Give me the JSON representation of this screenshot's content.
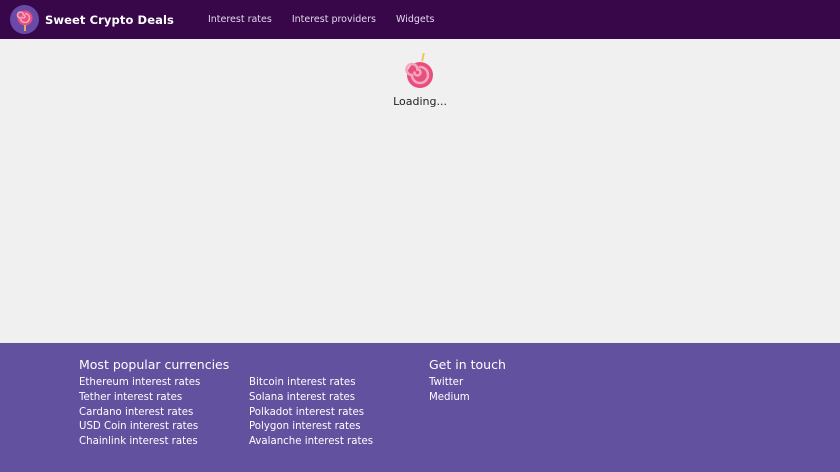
{
  "header": {
    "brand_name": "Sweet Crypto Deals",
    "nav": [
      {
        "label": "Interest rates"
      },
      {
        "label": "Interest providers"
      },
      {
        "label": "Widgets"
      }
    ]
  },
  "main": {
    "loading_text": "Loading..."
  },
  "footer": {
    "popular_heading": "Most popular currencies",
    "popular_col1": [
      {
        "label": "Ethereum interest rates"
      },
      {
        "label": "Tether interest rates"
      },
      {
        "label": "Cardano interest rates"
      },
      {
        "label": "USD Coin interest rates"
      },
      {
        "label": "Chainlink interest rates"
      }
    ],
    "popular_col2": [
      {
        "label": "Bitcoin interest rates"
      },
      {
        "label": "Solana interest rates"
      },
      {
        "label": "Polkadot interest rates"
      },
      {
        "label": "Polygon interest rates"
      },
      {
        "label": "Avalanche interest rates"
      }
    ],
    "contact_heading": "Get in touch",
    "contact_links": [
      {
        "label": "Twitter"
      },
      {
        "label": "Medium"
      }
    ]
  },
  "colors": {
    "header_bg": "#38074a",
    "footer_bg": "#61519f",
    "page_bg": "#f0f0f0",
    "logo_pink": "#e84f7d",
    "logo_light": "#f6a7bf"
  },
  "icons": {
    "brand": "lollipop-icon",
    "loader": "lollipop-spinner-icon"
  }
}
